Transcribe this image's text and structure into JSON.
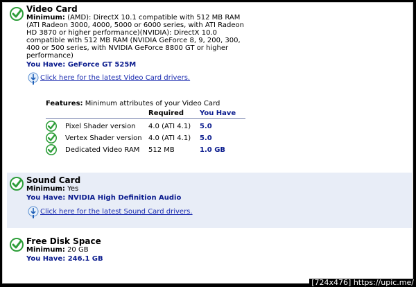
{
  "video": {
    "title": "Video Card",
    "min_label": "Minimum:",
    "min_lines": [
      " (AMD): DirectX 10.1 compatible with 512 MB RAM",
      "(ATI Radeon 3000, 4000, 5000 or 6000 series, with ATI Radeon",
      "HD 3870 or higher performance)(NVIDIA): DirectX 10.0",
      "compatible with 512 MB RAM (NVIDIA GeForce 8, 9, 200, 300,",
      "400 or 500 series, with NVIDIA GeForce 8800 GT or higher",
      "performance)"
    ],
    "have": "You Have: GeForce GT 525M",
    "driver_link": "Click here for the latest Video Card drivers.",
    "features": {
      "title_bold": "Features:",
      "title_rest": " Minimum attributes of your Video Card",
      "col_required": "Required",
      "col_have": "You Have",
      "rows": [
        {
          "name": "Pixel Shader version",
          "required": "4.0 (ATI 4.1)",
          "have": "5.0"
        },
        {
          "name": "Vertex Shader version",
          "required": "4.0 (ATI 4.1)",
          "have": "5.0"
        },
        {
          "name": "Dedicated Video RAM",
          "required": "512 MB",
          "have": "1.0 GB"
        }
      ]
    }
  },
  "sound": {
    "title": "Sound Card",
    "min_label": "Minimum:",
    "min_value": " Yes",
    "have": "You Have: NVIDIA High Definition Audio",
    "driver_link": "Click here for the latest Sound Card drivers."
  },
  "disk": {
    "title": "Free Disk Space",
    "min_label": "Minimum:",
    "min_value": " 20 GB",
    "have": "You Have: 246.1 GB"
  },
  "watermark": "[724x476] https://upic.me/",
  "colors": {
    "accent": "#0b1c8e",
    "link": "#1a2bb0",
    "check": "#2e9e3a",
    "band": "#e8edf7"
  }
}
